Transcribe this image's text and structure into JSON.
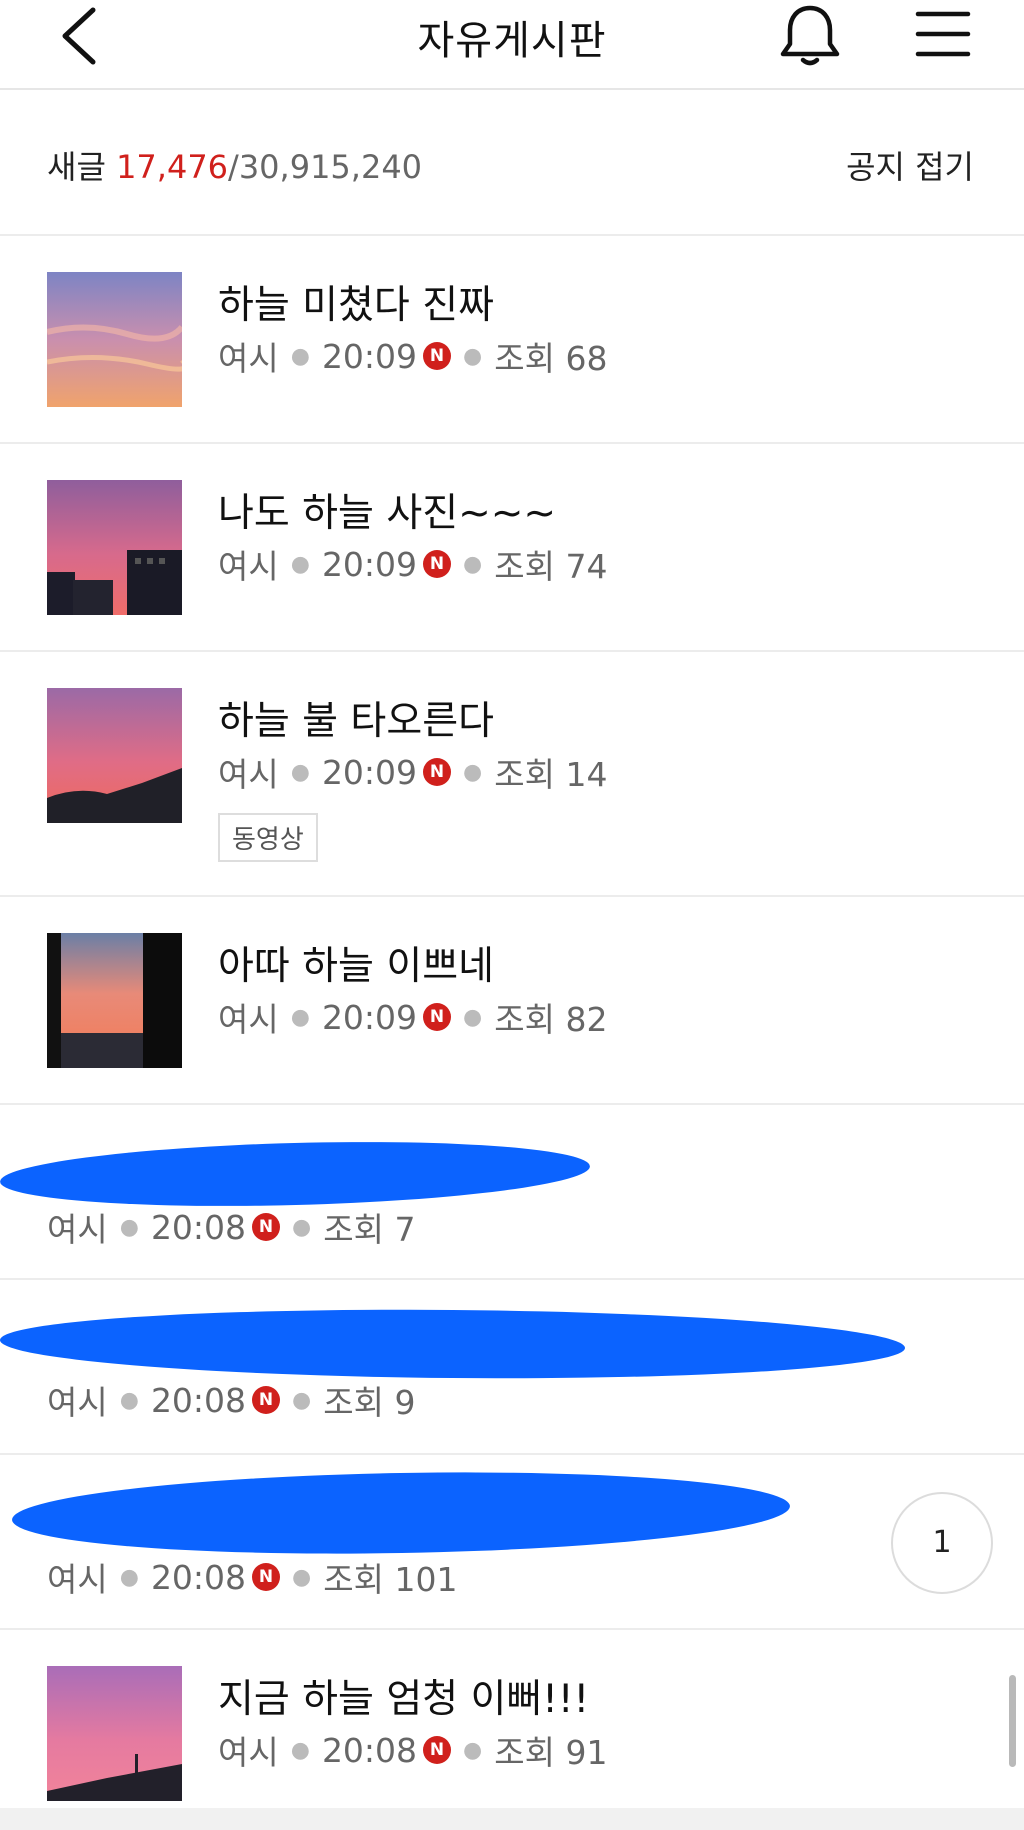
{
  "header": {
    "title": "자유게시판",
    "back_icon": "chevron-left-icon",
    "bell_icon": "bell-icon",
    "menu_icon": "hamburger-menu-icon"
  },
  "counts": {
    "new_label": "새글",
    "new_count": "17,476",
    "total": "/30,915,240",
    "fold_notice": "공지 접기"
  },
  "posts": [
    {
      "title": "하늘 미쳤다 진짜",
      "author": "여시",
      "time": "20:09",
      "badge": "N",
      "views": "조회 68",
      "thumb_colors": [
        "#7d84c4",
        "#c98fae",
        "#f0a36c"
      ]
    },
    {
      "title": "나도 하늘 사진~~~",
      "author": "여시",
      "time": "20:09",
      "badge": "N",
      "views": "조회 74",
      "thumb_colors": [
        "#8f5e9c",
        "#d76a8c",
        "#f06d6a"
      ]
    },
    {
      "title": "하늘 불 타오른다",
      "author": "여시",
      "time": "20:09",
      "badge": "N",
      "views": "조회 14",
      "tag": "동영상",
      "thumb_colors": [
        "#9b6aa6",
        "#e06c86",
        "#f06a5a"
      ]
    },
    {
      "title": "아따 하늘 이쁘네",
      "author": "여시",
      "time": "20:09",
      "badge": "N",
      "views": "조회 82",
      "thumb_colors": [
        "#6b7fa6",
        "#e88a78",
        "#f47a54"
      ]
    },
    {
      "title": "",
      "author": "여시",
      "time": "20:08",
      "badge": "N",
      "views": "조회 7"
    },
    {
      "title": "",
      "author": "여시",
      "time": "20:08",
      "badge": "N",
      "views": "조회 9"
    },
    {
      "title": "",
      "author": "여시",
      "time": "20:08",
      "badge": "N",
      "views": "조회 101"
    },
    {
      "title": "지금 하늘 엄청 이뻐!!!",
      "author": "여시",
      "time": "20:08",
      "badge": "N",
      "views": "조회 91",
      "thumb_colors": [
        "#a96db8",
        "#e57aa0",
        "#f2849a"
      ]
    }
  ],
  "page_button": "1",
  "colors": {
    "accent_red": "#d0201c",
    "redaction_blue": "#0b63ff"
  }
}
